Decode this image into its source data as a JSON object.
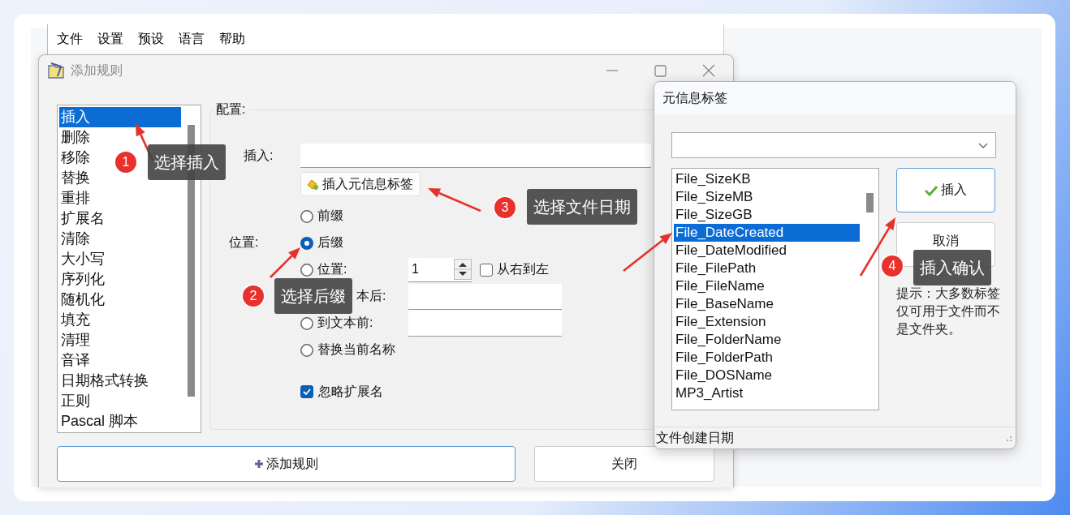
{
  "menu_bar": {
    "items": [
      "文件",
      "设置",
      "预设",
      "语言",
      "帮助"
    ]
  },
  "add_rule_dialog": {
    "title": "添加规则",
    "active": false,
    "rules": [
      {
        "label": "插入",
        "selected": true
      },
      {
        "label": "删除",
        "selected": false
      },
      {
        "label": "移除",
        "selected": false
      },
      {
        "label": "替换",
        "selected": false
      },
      {
        "label": "重排",
        "selected": false
      },
      {
        "label": "扩展名",
        "selected": false
      },
      {
        "label": "清除",
        "selected": false
      },
      {
        "label": "大小写",
        "selected": false
      },
      {
        "label": "序列化",
        "selected": false
      },
      {
        "label": "随机化",
        "selected": false
      },
      {
        "label": "填充",
        "selected": false
      },
      {
        "label": "清理",
        "selected": false
      },
      {
        "label": "音译",
        "selected": false
      },
      {
        "label": "日期格式转换",
        "selected": false
      },
      {
        "label": "正则",
        "selected": false
      },
      {
        "label": "Pascal 脚本",
        "selected": false
      }
    ],
    "config": {
      "group_label": "配置:",
      "insert_label": "插入:",
      "meta_button": "插入元信息标签",
      "position_label": "位置:",
      "options": [
        {
          "label": "前缀",
          "selected": false,
          "kind": "plain"
        },
        {
          "label": "后缀",
          "selected": true,
          "kind": "plain"
        },
        {
          "label": "位置:",
          "selected": false,
          "kind": "spin",
          "value": "1",
          "checkbox": {
            "label": "从右到左",
            "checked": false
          }
        },
        {
          "label": "本后:",
          "kind": "clipped"
        },
        {
          "label": "到文本前:",
          "selected": false,
          "kind": "text"
        },
        {
          "label": "替换当前名称",
          "selected": false,
          "kind": "plain"
        }
      ],
      "ignore_extension": {
        "label": "忽略扩展名",
        "checked": true
      }
    },
    "buttons": [
      {
        "label": "添加规则",
        "kind": "add"
      },
      {
        "label": "关闭",
        "kind": "plain"
      }
    ]
  },
  "meta_dialog": {
    "title": "元信息标签",
    "tags": [
      {
        "label": "File_SizeKB",
        "selected": false
      },
      {
        "label": "File_SizeMB",
        "selected": false
      },
      {
        "label": "File_SizeGB",
        "selected": false
      },
      {
        "label": "File_DateCreated",
        "selected": true
      },
      {
        "label": "File_DateModified",
        "selected": false
      },
      {
        "label": "File_FilePath",
        "selected": false
      },
      {
        "label": "File_FileName",
        "selected": false
      },
      {
        "label": "File_BaseName",
        "selected": false
      },
      {
        "label": "File_Extension",
        "selected": false
      },
      {
        "label": "File_FolderName",
        "selected": false
      },
      {
        "label": "File_FolderPath",
        "selected": false
      },
      {
        "label": "File_DOSName",
        "selected": false
      },
      {
        "label": "MP3_Artist",
        "selected": false
      }
    ],
    "insert_button": "插入",
    "cancel_button": "取消",
    "hint": "提示：大多数标签仅可用于文件而不是文件夹。",
    "status": "文件创建日期"
  },
  "callouts": [
    {
      "number": "1",
      "text": "选择插入"
    },
    {
      "number": "2",
      "text": "选择后缀"
    },
    {
      "number": "3",
      "text": "选择文件日期"
    },
    {
      "number": "4",
      "text": "插入确认"
    }
  ]
}
